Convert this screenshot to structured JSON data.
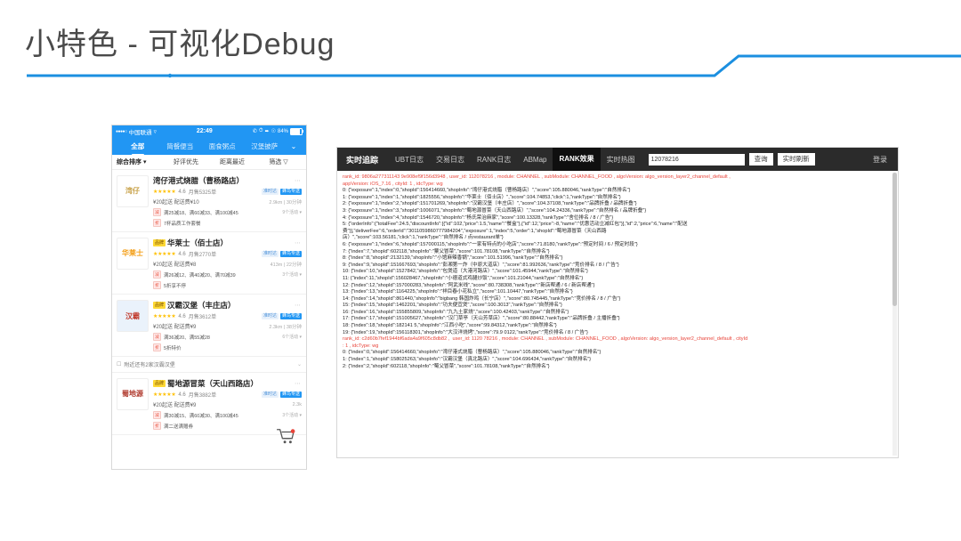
{
  "slide": {
    "title": "小特色 - 可视化Debug",
    "accent_color": "#1b8fe0"
  },
  "phone": {
    "status_bar": {
      "carrier": "中国联通",
      "signal_dots": "●●●●○",
      "wifi_icon": "wifi-icon",
      "time": "22:49",
      "battery_text": "84%",
      "icons": "phone-icon alarm-icon location-icon bluetooth-icon"
    },
    "category_tabs": [
      {
        "label": "全部",
        "active": true
      },
      {
        "label": "简餐便当",
        "active": false
      },
      {
        "label": "面食粥点",
        "active": false
      },
      {
        "label": "汉堡披萨",
        "active": false
      }
    ],
    "category_more_icon": "chevron-down-icon",
    "filters": [
      "综合排序 ▾",
      "好评优先",
      "距离最近",
      "筛选 ▽"
    ],
    "shops": [
      {
        "logo_text": "湾仔",
        "logo_sub": "港式烧腊",
        "brand_tag": "",
        "name": "湾仔港式烧腊（曹杨路店）",
        "stars": "★★★★★",
        "rating": "4.6",
        "sales": "月售5325单",
        "tags": [
          "准时达",
          "蜂鸟专送"
        ],
        "delivery": "¥20起送  配送费¥10",
        "distance": "2.9km",
        "eta": "30分钟",
        "promos": [
          {
            "icon": "减",
            "text": "满25减18、满60减33、满100减45"
          },
          {
            "icon": "折",
            "text": "7杯品质工作套餐"
          }
        ],
        "promo_count": "9个活动 ▾"
      },
      {
        "logo_text": "华莱士",
        "logo_sub": "",
        "brand_tag": "品牌",
        "name": "华莱士（佰士店）",
        "stars": "★★★★★",
        "rating": "4.6",
        "sales": "月售2770单",
        "tags": [
          "准时达",
          "蜂鸟专送"
        ],
        "delivery": "¥20起送  配送费¥8",
        "distance": "413m",
        "eta": "22分钟",
        "promos": [
          {
            "icon": "减",
            "text": "满26减12、满40减20、满70减39"
          },
          {
            "icon": "折",
            "text": "5折享不停"
          }
        ],
        "promo_count": "3个活动 ▾"
      },
      {
        "logo_text": "汉霸",
        "logo_sub": "汉堡",
        "brand_tag": "品牌",
        "name": "汉霸汉堡（丰庄店）",
        "stars": "★★★★★",
        "rating": "4.6",
        "sales": "月售3612单",
        "tags": [
          "准时达",
          "蜂鸟专送"
        ],
        "delivery": "¥20起送  配送费¥9",
        "distance": "2.3km",
        "eta": "38分钟",
        "promos": [
          {
            "icon": "减",
            "text": "满36减20、满55减28"
          },
          {
            "icon": "折",
            "text": "5折特价"
          }
        ],
        "promo_count": "6个活动 ▾"
      }
    ],
    "nearby_row": {
      "icon": "shop-icon",
      "text": "附近还有2家汉霸汉堡",
      "chevron": "⌄"
    },
    "last_shop": {
      "logo_text": "蜀地源",
      "logo_sub": "冒菜",
      "brand_tag": "品牌",
      "name": "蜀地源冒菜（天山西路店）",
      "stars": "★★★★★",
      "rating": "4.6",
      "sales": "月售3882单",
      "tags": [
        "准时达",
        "蜂鸟专送"
      ],
      "delivery": "¥20起送  配送费¥9",
      "distance": "2.3k",
      "eta": "",
      "promos": [
        {
          "icon": "减",
          "text": "满30减15、满60减30、满100减45"
        },
        {
          "icon": "折",
          "text": "满二送满赠券"
        }
      ],
      "promo_count": "3个活动 ▾"
    },
    "cart_icon": "shopping-cart-icon"
  },
  "debug": {
    "nav": {
      "brand": "实时追踪",
      "items": [
        {
          "label": "UBT日志",
          "active": false
        },
        {
          "label": "交易日志",
          "active": false
        },
        {
          "label": "RANK日志",
          "active": false
        },
        {
          "label": "ABMap",
          "active": false
        },
        {
          "label": "RANK效果",
          "active": true
        },
        {
          "label": "实时热图",
          "active": false
        }
      ],
      "search_value": "12078216",
      "search_placeholder": "",
      "query_button": "查询",
      "refresh_button": "实时刷新",
      "login_label": "登录"
    },
    "logs": [
      {
        "type": "hdr",
        "text": "rank_id: 9806a277311143 9e908ef9f156d3948 , user_id: 112078216 , module: CHANNEL , subModule: CHANNEL_FOOD , algoVersion: algo_version_layer2_channel_default ,"
      },
      {
        "type": "hdr",
        "text": "appVersion: iOS_7.16 , cityId: 1 , idcType: wg"
      },
      {
        "type": "log",
        "text": "0: {\"exposure\":1,\"index\":0,\"shopId\":156414660,\"shopInfo\":\"湾仔港式烧腊（曹杨路店）\",\"score\":105.880046,\"rankType\":\"自然排名\"}"
      },
      {
        "type": "log",
        "text": "1: {\"exposure\":1,\"index\":1,\"shopId\":1825556,\"shopInfo\":\"华莱士（佰士店）\",\"score\":104.74853,\"click\":1,\"rankType\":\"自然排名\"}"
      },
      {
        "type": "log",
        "text": "2: {\"exposure\":1,\"index\":2,\"shopId\":151701269,\"shopInfo\":\"汉霸汉堡（丰庄店）\",\"score\":104.37108,\"rankType\":\"品牌折叠 / 品牌折叠\"}"
      },
      {
        "type": "log",
        "text": "3: {\"exposure\":1,\"index\":3,\"shopId\":1006071,\"shopInfo\":\"蜀地源冒菜（天山西路店）\",\"score\":104.24336,\"rankType\":\"自然排名 / 品牌折叠\"}"
      },
      {
        "type": "log",
        "text": "4: {\"exposure\":1,\"index\":4,\"shopId\":1546720,\"shopInfo\":\"杨氏荣治麻家\",\"score\":100.13328,\"rankType\":\"舍位排名 / 8 / 广告\"}"
      },
      {
        "type": "log",
        "text": "5: {\"orderInfo\":{\"totalFee\":24.5,\"discountInfo\":[{\"id\":102,\"price\":1.5,\"name\":\"餐盒\"},{\"id\":12,\"price\":-8,\"name\":\"优惠活动立减红包\"}],\"id\":2,\"price\":6,\"name\":\"配送"
      },
      {
        "type": "log",
        "text": "费\"}],\"deliverFee\":6,\"orderId\":\"3011059860777984204\",\"exposure\":1,\"index\":5,\"order\":1,\"shopId\":\"蜀地源冒菜（天山西路"
      },
      {
        "type": "log",
        "text": "店）\",\"score\":103.56181,\"click\":1,\"rankType\":\"自然排名 / 点restaurant单\"}"
      },
      {
        "type": "log",
        "text": "6: {\"exposure\":1,\"index\":6,\"shopId\":157000115,\"shopInfo\":\"一家有特点的小吃店\",\"score\":71.8180,\"rankType\":\"预定时间 / 6 / 预定时段\"}"
      },
      {
        "type": "log",
        "text": "7: {\"index\":7,\"shopId\":602118,\"shopInfo\":\"粟父冒菜\",\"score\":101.78108,\"rankType\":\"自然排名\"}"
      },
      {
        "type": "log",
        "text": "8: {\"index\":8,\"shopId\":2132139,\"shopInfo\":\"小馆麻辣香锅\",\"score\":101.51996,\"rankType\":\"自然排名\"}"
      },
      {
        "type": "log",
        "text": "9: {\"index\":9,\"shopId\":151667693,\"shopInfo\":\"彭湘第一炸（中原大道店）\",\"score\":81.992636,\"rankType\":\"竞价排名 / 8 / 广告\"}"
      },
      {
        "type": "log",
        "text": "10: {\"index\":10,\"shopId\":1527842,\"shopInfo\":\"包煲道（大港河路店）\",\"score\":101.45944,\"rankType\":\"自然排名\"}"
      },
      {
        "type": "log",
        "text": "11: {\"index\":11,\"shopId\":156028467,\"shopInfo\":\"小德道式鸡腿炒饭\",\"score\":101.21044,\"rankType\":\"自然排名\"}"
      },
      {
        "type": "log",
        "text": "12: {\"index\":12,\"shopId\":157000283,\"shopInfo\":\"阿武米线\",\"score\":80.738308,\"rankType\":\"新店帮通 / 6 / 新店帮通\"}"
      },
      {
        "type": "log",
        "text": "13: {\"index\":13,\"shopId\":1164225,\"shopInfo\":\"祥目春小花私立\",\"score\":101.10447,\"rankType\":\"自然排名\"}"
      },
      {
        "type": "log",
        "text": "14: {\"index\":14,\"shopId\":861440,\"shopInfo\":\"bigbang 韩国炸鸡（长宁店）\",\"score\":80.745445,\"rankType\":\"竞价排名 / 8 / 广告\"}"
      },
      {
        "type": "log",
        "text": "15: {\"index\":15,\"shopId\":1462201,\"shopInfo\":\"功夫便宜煲\",\"score\":100.3013\",\"rankType\":\"自然排名\"}"
      },
      {
        "type": "log",
        "text": "16: {\"index\":16,\"shopId\":155855809,\"shopInfo\":\"九九土家烧\",\"score\":100.42403,\"rankType\":\"自然排名\"}"
      },
      {
        "type": "log",
        "text": "17: {\"index\":17,\"shopId\":151005627,\"shopInfo\":\"汉门草亭（天山芳草店）\",\"score\":80.88442,\"rankType\":\"品牌折叠 / 主播折叠\"}"
      },
      {
        "type": "log",
        "text": "18: {\"index\":18,\"shopId\":182141 5,\"shopInfo\":\"江西小吃\",\"score\":99.84312,\"rankType\":\"自然排名\"}"
      },
      {
        "type": "log",
        "text": "19: {\"index\":19,\"shopId\":156118301,\"shopInfo\":\"大汉洋烧烤\",\"score\":79.9 0122,\"rankType\":\"竞价排名 / 8 / 广告\"}"
      },
      {
        "type": "hdr",
        "text": "rank_id: c2d60b7fef1944bf6ada4a9f605c8db82 ,  user_id: 1120 78216 , module: CHANNEL , subModule: CHANNEL_FOOD , algoVersion: algo_version_layer2_channel_default , cityId"
      },
      {
        "type": "hdr",
        "text": ": 1 , idcType: wg"
      },
      {
        "type": "log",
        "text": "0: {\"index\":0,\"shopId\":156414660,\"shopInfo\":\"湾仔港式烧腊（曹杨路店）\",\"score\":105.880046,\"rankType\":\"自然排名\"}"
      },
      {
        "type": "log",
        "text": "1: {\"index\":1,\"shopId\":158025263,\"shopInfo\":\"汉霸汉堡（真北路店）\",\"score\":104.696434,\"rankType\":\"自然排名\"}"
      },
      {
        "type": "log",
        "text": "2: {\"index\":2,\"shopId\":602118,\"shopInfo\":\"蜀父冒菜\",\"score\":101.78108,\"rankType\":\"自然排名\"}"
      }
    ]
  }
}
